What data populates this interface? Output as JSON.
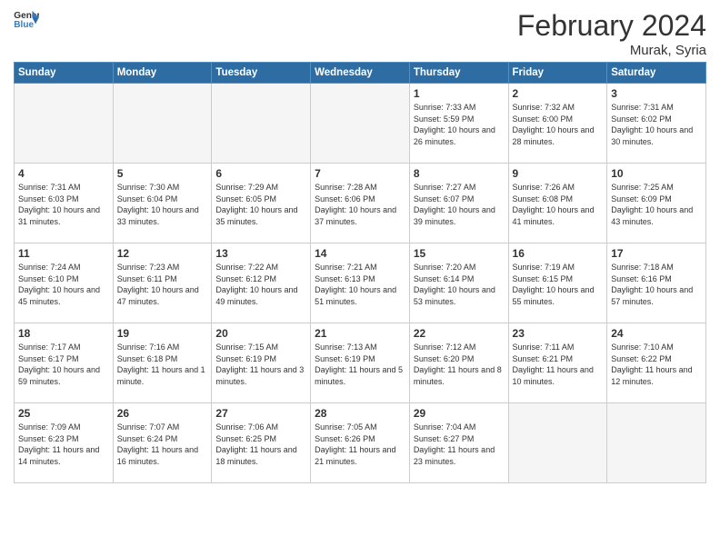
{
  "header": {
    "logo_general": "General",
    "logo_blue": "Blue",
    "title": "February 2024",
    "location": "Murak, Syria"
  },
  "days_of_week": [
    "Sunday",
    "Monday",
    "Tuesday",
    "Wednesday",
    "Thursday",
    "Friday",
    "Saturday"
  ],
  "weeks": [
    [
      {
        "day": "",
        "empty": true
      },
      {
        "day": "",
        "empty": true
      },
      {
        "day": "",
        "empty": true
      },
      {
        "day": "",
        "empty": true
      },
      {
        "day": "1",
        "sunrise": "7:33 AM",
        "sunset": "5:59 PM",
        "daylight": "10 hours and 26 minutes."
      },
      {
        "day": "2",
        "sunrise": "7:32 AM",
        "sunset": "6:00 PM",
        "daylight": "10 hours and 28 minutes."
      },
      {
        "day": "3",
        "sunrise": "7:31 AM",
        "sunset": "6:02 PM",
        "daylight": "10 hours and 30 minutes."
      }
    ],
    [
      {
        "day": "4",
        "sunrise": "7:31 AM",
        "sunset": "6:03 PM",
        "daylight": "10 hours and 31 minutes."
      },
      {
        "day": "5",
        "sunrise": "7:30 AM",
        "sunset": "6:04 PM",
        "daylight": "10 hours and 33 minutes."
      },
      {
        "day": "6",
        "sunrise": "7:29 AM",
        "sunset": "6:05 PM",
        "daylight": "10 hours and 35 minutes."
      },
      {
        "day": "7",
        "sunrise": "7:28 AM",
        "sunset": "6:06 PM",
        "daylight": "10 hours and 37 minutes."
      },
      {
        "day": "8",
        "sunrise": "7:27 AM",
        "sunset": "6:07 PM",
        "daylight": "10 hours and 39 minutes."
      },
      {
        "day": "9",
        "sunrise": "7:26 AM",
        "sunset": "6:08 PM",
        "daylight": "10 hours and 41 minutes."
      },
      {
        "day": "10",
        "sunrise": "7:25 AM",
        "sunset": "6:09 PM",
        "daylight": "10 hours and 43 minutes."
      }
    ],
    [
      {
        "day": "11",
        "sunrise": "7:24 AM",
        "sunset": "6:10 PM",
        "daylight": "10 hours and 45 minutes."
      },
      {
        "day": "12",
        "sunrise": "7:23 AM",
        "sunset": "6:11 PM",
        "daylight": "10 hours and 47 minutes."
      },
      {
        "day": "13",
        "sunrise": "7:22 AM",
        "sunset": "6:12 PM",
        "daylight": "10 hours and 49 minutes."
      },
      {
        "day": "14",
        "sunrise": "7:21 AM",
        "sunset": "6:13 PM",
        "daylight": "10 hours and 51 minutes."
      },
      {
        "day": "15",
        "sunrise": "7:20 AM",
        "sunset": "6:14 PM",
        "daylight": "10 hours and 53 minutes."
      },
      {
        "day": "16",
        "sunrise": "7:19 AM",
        "sunset": "6:15 PM",
        "daylight": "10 hours and 55 minutes."
      },
      {
        "day": "17",
        "sunrise": "7:18 AM",
        "sunset": "6:16 PM",
        "daylight": "10 hours and 57 minutes."
      }
    ],
    [
      {
        "day": "18",
        "sunrise": "7:17 AM",
        "sunset": "6:17 PM",
        "daylight": "10 hours and 59 minutes."
      },
      {
        "day": "19",
        "sunrise": "7:16 AM",
        "sunset": "6:18 PM",
        "daylight": "11 hours and 1 minute."
      },
      {
        "day": "20",
        "sunrise": "7:15 AM",
        "sunset": "6:19 PM",
        "daylight": "11 hours and 3 minutes."
      },
      {
        "day": "21",
        "sunrise": "7:13 AM",
        "sunset": "6:19 PM",
        "daylight": "11 hours and 5 minutes."
      },
      {
        "day": "22",
        "sunrise": "7:12 AM",
        "sunset": "6:20 PM",
        "daylight": "11 hours and 8 minutes."
      },
      {
        "day": "23",
        "sunrise": "7:11 AM",
        "sunset": "6:21 PM",
        "daylight": "11 hours and 10 minutes."
      },
      {
        "day": "24",
        "sunrise": "7:10 AM",
        "sunset": "6:22 PM",
        "daylight": "11 hours and 12 minutes."
      }
    ],
    [
      {
        "day": "25",
        "sunrise": "7:09 AM",
        "sunset": "6:23 PM",
        "daylight": "11 hours and 14 minutes."
      },
      {
        "day": "26",
        "sunrise": "7:07 AM",
        "sunset": "6:24 PM",
        "daylight": "11 hours and 16 minutes."
      },
      {
        "day": "27",
        "sunrise": "7:06 AM",
        "sunset": "6:25 PM",
        "daylight": "11 hours and 18 minutes."
      },
      {
        "day": "28",
        "sunrise": "7:05 AM",
        "sunset": "6:26 PM",
        "daylight": "11 hours and 21 minutes."
      },
      {
        "day": "29",
        "sunrise": "7:04 AM",
        "sunset": "6:27 PM",
        "daylight": "11 hours and 23 minutes."
      },
      {
        "day": "",
        "empty": true
      },
      {
        "day": "",
        "empty": true
      }
    ]
  ]
}
